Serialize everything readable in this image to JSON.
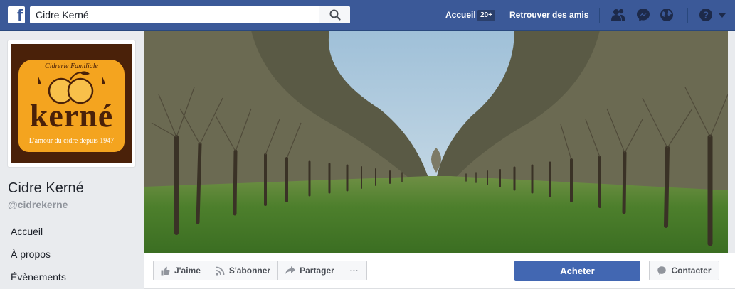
{
  "topbar": {
    "search_value": "Cidre Kerné",
    "home_label": "Accueil",
    "home_badge": "20+",
    "find_friends_label": "Retrouver des amis",
    "icons": [
      "friend-requests-icon",
      "messenger-icon",
      "notifications-globe-icon",
      "help-icon",
      "account-menu-chevron-icon"
    ],
    "brand_color": "#3b5998"
  },
  "page": {
    "logo": {
      "top_text": "Cidrerie Familiale",
      "name": "kerné",
      "tagline": "L'amour du cidre depuis 1947"
    },
    "name": "Cidre Kerné",
    "handle": "@cidrekerne",
    "nav": [
      "Accueil",
      "À propos",
      "Évènements"
    ]
  },
  "actions": {
    "like_label": "J'aime",
    "follow_label": "S'abonner",
    "share_label": "Partager",
    "more_label": "···",
    "buy_label": "Acheter",
    "contact_label": "Contacter",
    "buy_color": "#4267b2"
  }
}
